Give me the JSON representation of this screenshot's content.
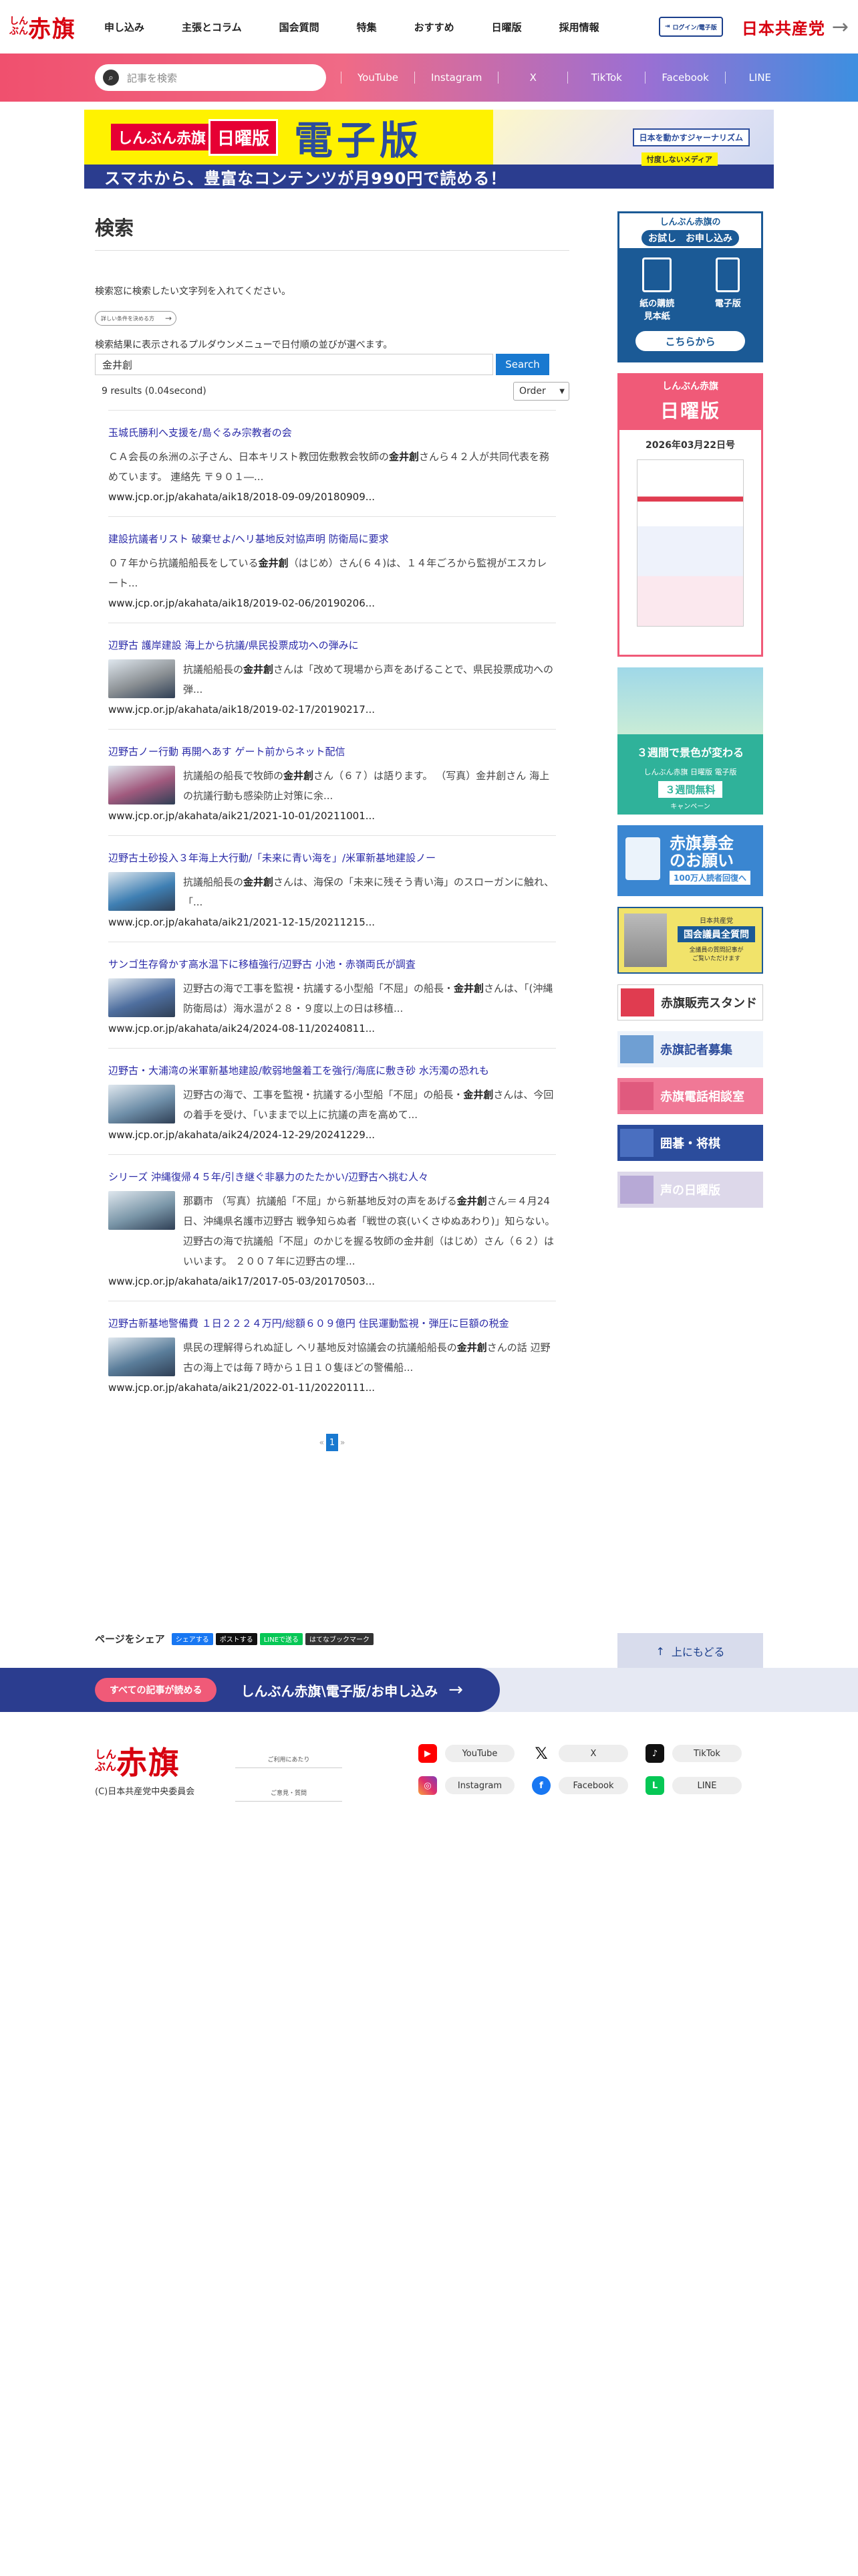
{
  "header": {
    "logo_kana": "しんぶん",
    "logo_kanji": "赤旗",
    "nav": [
      "申し込み",
      "主張とコラム",
      "国会質問",
      "特集",
      "おすすめ",
      "日曜版",
      "採用情報"
    ],
    "login_label": "ログイン/電子版",
    "party_name": "日本共産党"
  },
  "subbar": {
    "search_placeholder": "記事を検索",
    "sns": [
      "YouTube",
      "Instagram",
      "X",
      "TikTok",
      "Facebook",
      "LINE"
    ]
  },
  "banner": {
    "tag_red": "しんぶん赤旗",
    "tag_sunday": "日曜版",
    "edition": "電子版",
    "badge1": "日本を動かすジャーナリズム",
    "badge2": "忖度しないメディア",
    "bottom": "スマホから、豊富なコンテンツが月990円で読める！"
  },
  "main": {
    "title": "検索",
    "intro": "検索窓に検索したい文字列を入れてください。",
    "adv_button": "詳しい条件を決める方",
    "order_note": "検索結果に表示されるプルダウンメニューで日付順の並びが選べます。",
    "query": "金井創",
    "search_button": "Search",
    "result_count": "9 results (0.04second)",
    "order_label": "Order"
  },
  "results": [
    {
      "title": "玉城氏勝利へ支援を/島ぐるみ宗教者の会",
      "snippet_before": "ＣＡ会長の糸洲のぶ子さん、日本キリスト教団佐敷教会牧師の",
      "keyword": "金井創",
      "snippet_after": "さんら４２人が共同代表を務めています。 連絡先 〒９０１―...",
      "url": "www.jcp.or.jp/akahata/aik18/2018-09-09/20180909...",
      "has_thumb": false
    },
    {
      "title": "建設抗議者リスト 破棄せよ/ヘリ基地反対協声明 防衛局に要求",
      "snippet_before": "０７年から抗議船船長をしている",
      "keyword": "金井創",
      "snippet_after": "（はじめ）さん(６４)は、１４年ごろから監視がエスカレート...",
      "url": "www.jcp.or.jp/akahata/aik18/2019-02-06/20190206...",
      "has_thumb": false
    },
    {
      "title": "辺野古 護岸建設 海上から抗議/県民投票成功への弾みに",
      "snippet_before": "抗議船船長の",
      "keyword": "金井創",
      "snippet_after": "さんは「改めて現場から声をあげることで、県民投票成功への弾...",
      "url": "www.jcp.or.jp/akahata/aik18/2019-02-17/20190217...",
      "has_thumb": true,
      "thumb_color": "#8a8f93"
    },
    {
      "title": "辺野古ノー行動 再開へあす ゲート前からネット配信",
      "snippet_before": "抗議船の船長で牧師の",
      "keyword": "金井創",
      "snippet_after": "さん（６７）は語ります。 （写真）金井創さん 海上の抗議行動も感染防止対策に余...",
      "url": "www.jcp.or.jp/akahata/aik21/2021-10-01/20211001...",
      "has_thumb": true,
      "thumb_color": "#a15a7e"
    },
    {
      "title": "辺野古土砂投入３年海上大行動/「未来に青い海を」/米軍新基地建設ノー",
      "snippet_before": "抗議船船長の",
      "keyword": "金井創",
      "snippet_after": "さんは、海保の「未来に残そう青い海」のスローガンに触れ、「...",
      "url": "www.jcp.or.jp/akahata/aik21/2021-12-15/20211215...",
      "has_thumb": true,
      "thumb_color": "#3f7fb3"
    },
    {
      "title": "サンゴ生存脅かす高水温下に移植強行/辺野古 小池・赤嶺両氏が調査",
      "snippet_before": "辺野古の海で工事を監視・抗議する小型船「不屈」の船長・",
      "keyword": "金井創",
      "snippet_after": "さんは、「(沖縄防衛局は）海水温が２８・９度以上の日は移植...",
      "url": "www.jcp.or.jp/akahata/aik24/2024-08-11/20240811...",
      "has_thumb": true,
      "thumb_color": "#4f6f9f"
    },
    {
      "title": "辺野古・大浦湾の米軍新基地建設/軟弱地盤着工を強行/海底に敷き砂 水汚濁の恐れも",
      "snippet_before": "辺野古の海で、工事を監視・抗議する小型船「不屈」の船長・",
      "keyword": "金井創",
      "snippet_after": "さんは、今回の着手を受け、「いままで以上に抗議の声を高めて...",
      "url": "www.jcp.or.jp/akahata/aik24/2024-12-29/20241229...",
      "has_thumb": true,
      "thumb_color": "#6f8fa9"
    },
    {
      "title": "シリーズ 沖縄復帰４５年/引き継ぐ非暴力のたたかい/辺野古へ挑む人々",
      "snippet_before": "那覇市 （写真）抗議船「不屈」から新基地反対の声をあげる",
      "keyword": "金井創",
      "snippet_after": "さん＝４月24日、沖縄県名護市辺野古 戦争知らぬ者「戦世の哀(いくさゆぬあわり)」知らない。辺野古の海で抗議船「不屈」のかじを握る牧師の金井創（はじめ）さん（６２）はいいます。 ２００７年に辺野古の埋...",
      "url": "www.jcp.or.jp/akahata/aik17/2017-05-03/20170503...",
      "has_thumb": true,
      "thumb_color": "#7a96a8"
    },
    {
      "title": "辺野古新基地警備費 １日２２２４万円/総額６０９億円 住民運動監視・弾圧に巨額の税金",
      "snippet_before": "県民の理解得られぬ証し ヘリ基地反対協議会の抗議船船長の",
      "keyword": "金井創",
      "snippet_after": "さんの話 辺野古の海上では毎７時から１日１０隻ほどの警備船...",
      "url": "www.jcp.or.jp/akahata/aik21/2022-01-11/20220111...",
      "has_thumb": true,
      "thumb_color": "#5a7d9a"
    }
  ],
  "pager": {
    "prev": "«",
    "current": "1",
    "next": "»"
  },
  "share": {
    "label": "ページをシェア",
    "buttons": [
      "シェアする",
      "ポストする",
      "LINEで送る",
      "はてなブックマーク"
    ]
  },
  "sidebar": {
    "trial_title": "しんぶん赤旗の",
    "trial_sub": "お試し　お申し込み",
    "trial_icon1": "紙の購読\n見本紙",
    "trial_icon2": "電子版",
    "trial_go": "こちらから",
    "sunday_top": "しんぶん赤旗",
    "sunday_big": "日曜版",
    "sunday_date": "2026年03月22日号",
    "green_l1": "３週間で景色が変わる",
    "green_l2": "しんぶん赤旗 日曜版 電子版",
    "green_l3": "３週間無料",
    "green_l4": "キャンペーン",
    "fund_title": "赤旗募金\nのお願い",
    "fund_sub": "100万人読者回復へ",
    "diet_a": "日本共産党",
    "diet_b": "国会議員全質問",
    "diet_c": "全議員の質問記事が\nご覧いただけます",
    "stand": "赤旗販売スタンド",
    "reporter": "赤旗記者募集",
    "phone": "赤旗電話相談室",
    "igo": "囲碁・将棋",
    "voice": "声の日曜版",
    "to_top": "上にもどる"
  },
  "bottombar": {
    "read_all": "すべての記事が読める",
    "subscribe": "しんぶん赤旗\\電子版/お申し込み"
  },
  "footer": {
    "logo_kana": "しんぶん",
    "logo_kanji": "赤旗",
    "copyright": "(C)日本共産党中央委員会",
    "links": [
      "ご利用にあたり",
      "ご意見・質問"
    ],
    "sns": [
      "YouTube",
      "X",
      "TikTok",
      "Instagram",
      "Facebook",
      "LINE"
    ]
  },
  "colors": {
    "brand_red": "#d7000f",
    "navy": "#2b3d8f",
    "link_blue": "#2a2aa8",
    "button_blue": "#1979d0",
    "pink": "#f05a78"
  }
}
